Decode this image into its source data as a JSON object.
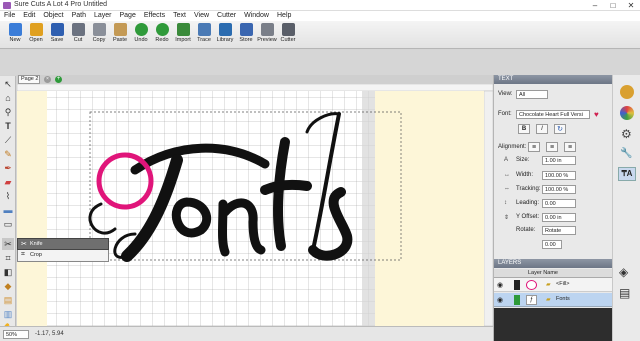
{
  "window": {
    "title": "Sure Cuts A Lot 4 Pro Untitled",
    "minimize": "–",
    "maximize": "□",
    "close": "✕"
  },
  "menu": [
    "File",
    "Edit",
    "Object",
    "Path",
    "Layer",
    "Page",
    "Effects",
    "Text",
    "View",
    "Cutter",
    "Window",
    "Help"
  ],
  "toolbar": [
    {
      "label": "New",
      "color": "#3b7dd8"
    },
    {
      "label": "Open",
      "color": "#e0a020"
    },
    {
      "label": "Save",
      "color": "#2f5fb0"
    },
    {
      "label": "Cut",
      "color": "#6b7280"
    },
    {
      "label": "Copy",
      "color": "#8a8f99"
    },
    {
      "label": "Paste",
      "color": "#c49a55"
    },
    {
      "label": "Undo",
      "color": "#2f9a3a"
    },
    {
      "label": "Redo",
      "color": "#2f9a3a"
    },
    {
      "label": "Import",
      "color": "#3a8a3a"
    },
    {
      "label": "Trace",
      "color": "#4a7ab5"
    },
    {
      "label": "Library",
      "color": "#2b6cb0"
    },
    {
      "label": "Store",
      "color": "#3a66b0"
    },
    {
      "label": "Preview",
      "color": "#7a7f89"
    },
    {
      "label": "Cutter",
      "color": "#5a5f69"
    }
  ],
  "document": {
    "tab_label": "Page 2",
    "canvas_text": "Fonts",
    "zoom": "50%",
    "coords": "-1.17, 5.94"
  },
  "context_menu": {
    "items": [
      "Knife",
      "Crop"
    ]
  },
  "text_panel": {
    "header": "TEXT",
    "view_label": "View:",
    "view_value": "All",
    "font_label": "Font:",
    "font_value": "Chocolate Heart Full Versi",
    "style_bold": "B",
    "style_italic": "I",
    "alignment_label": "Alignment:",
    "fields": [
      {
        "label": "Size:",
        "value": "1.00 in"
      },
      {
        "label": "Width:",
        "value": "100.00 %"
      },
      {
        "label": "Tracking:",
        "value": "100.00 %"
      },
      {
        "label": "Leading:",
        "value": "0.00"
      },
      {
        "label": "Y Offset:",
        "value": "0.00 in"
      },
      {
        "label": "Rotate:",
        "value": "Rotate"
      },
      {
        "label": "",
        "value": "0.00"
      }
    ]
  },
  "layers_panel": {
    "header": "LAYERS",
    "column_header": "Layer Name",
    "rows": [
      {
        "name": "<Fill>"
      },
      {
        "name": "Fonts"
      }
    ]
  },
  "colors": {
    "accent_pink": "#e0157a",
    "page_cream": "#fdf6d8",
    "selected_layer": "#bcd4f0"
  }
}
